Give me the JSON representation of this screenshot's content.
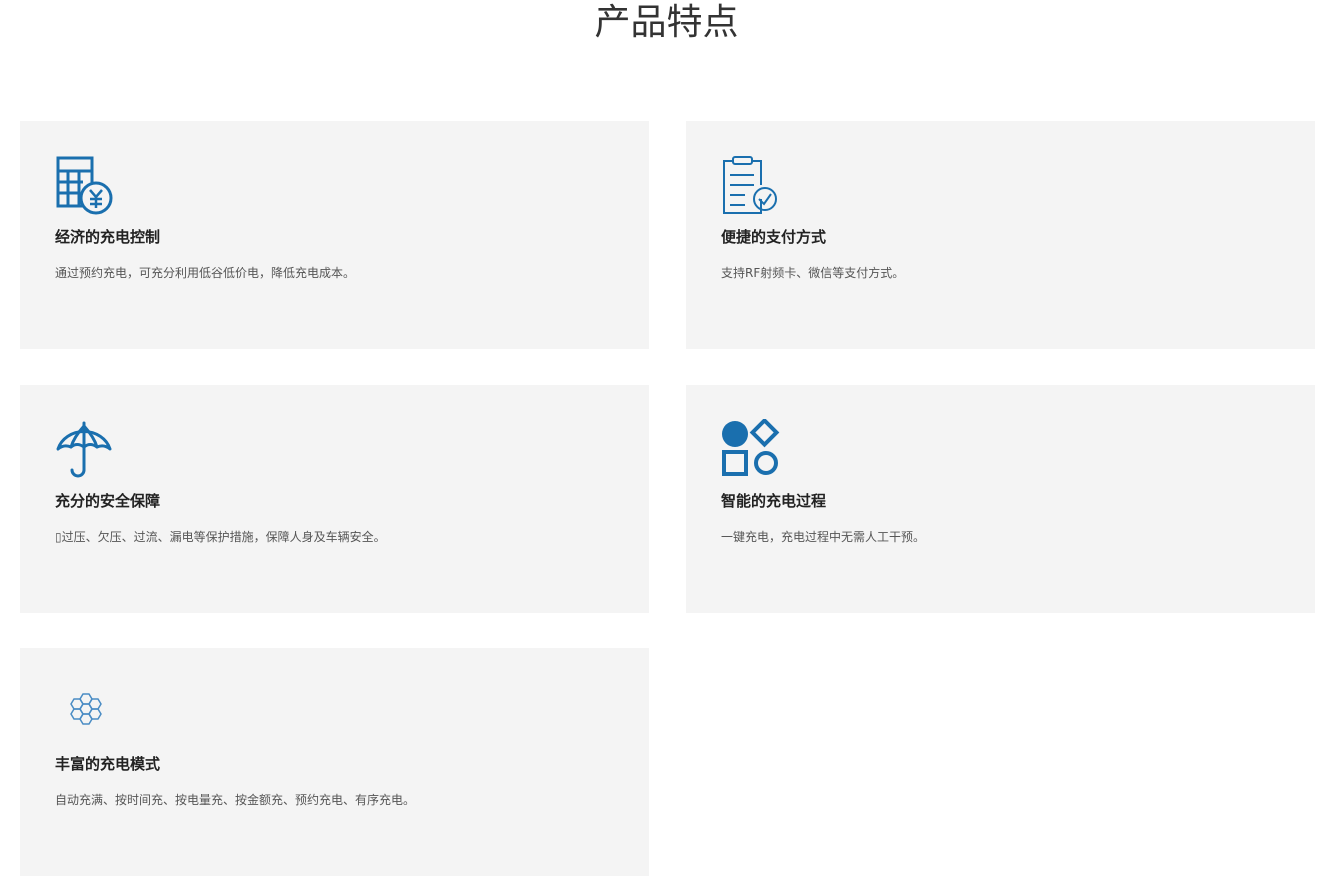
{
  "section": {
    "title": "产品特点"
  },
  "features": [
    {
      "icon": "calculator-yen-icon",
      "title": "经济的充电控制",
      "desc": "通过预约充电，可充分利用低谷低价电，降低充电成本。"
    },
    {
      "icon": "clipboard-check-icon",
      "title": "便捷的支付方式",
      "desc": "支持RF射频卡、微信等支付方式。"
    },
    {
      "icon": "umbrella-icon",
      "title": "充分的安全保障",
      "desc": "▯过压、欠压、过流、漏电等保护措施，保障人身及车辆安全。"
    },
    {
      "icon": "shapes-icon",
      "title": "智能的充电过程",
      "desc": "一键充电，充电过程中无需人工干预。"
    },
    {
      "icon": "hexagon-cluster-icon",
      "title": "丰富的充电模式",
      "desc": "自动充满、按时间充、按电量充、按金额充、预约充电、有序充电。"
    }
  ],
  "colors": {
    "accent": "#1a6fae",
    "card_bg": "#f4f4f4",
    "title_text": "#333333",
    "body_text": "#555555"
  }
}
